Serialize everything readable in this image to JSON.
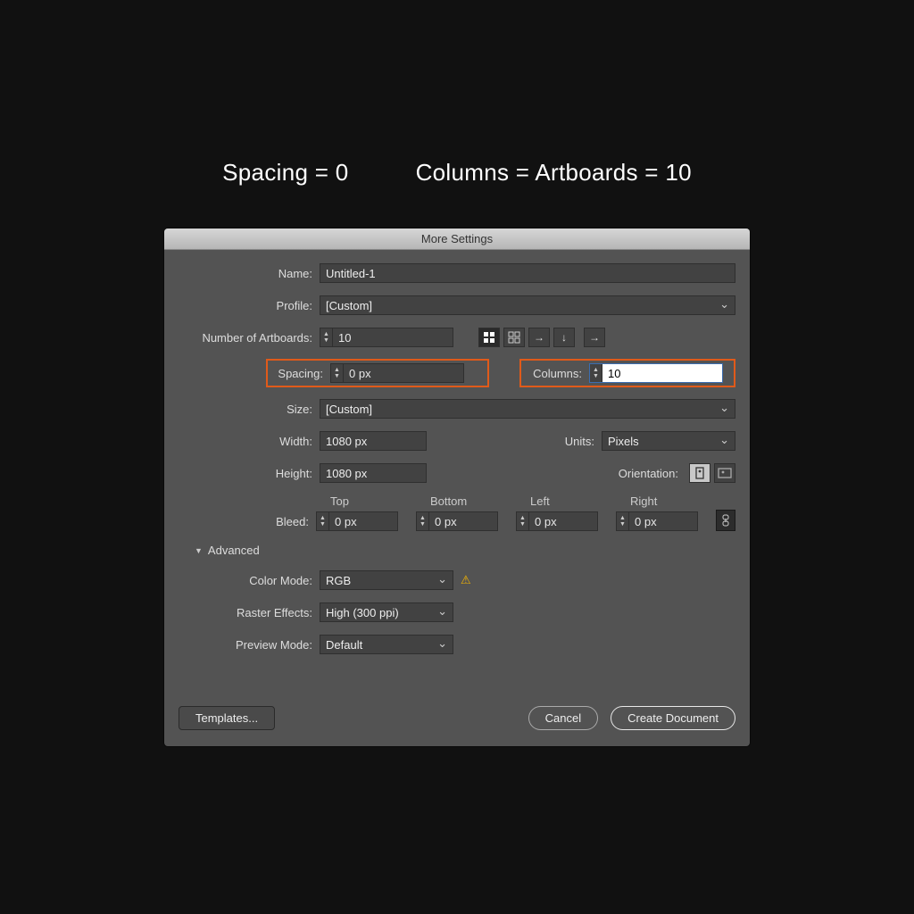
{
  "caption": {
    "left": "Spacing = 0",
    "right": "Columns = Artboards = 10"
  },
  "dialog": {
    "title": "More Settings",
    "name_label": "Name:",
    "name_value": "Untitled-1",
    "profile_label": "Profile:",
    "profile_value": "[Custom]",
    "artboards_label": "Number of Artboards:",
    "artboards_value": "10",
    "spacing_label": "Spacing:",
    "spacing_value": "0 px",
    "columns_label": "Columns:",
    "columns_value": "10",
    "size_label": "Size:",
    "size_value": "[Custom]",
    "width_label": "Width:",
    "width_value": "1080 px",
    "units_label": "Units:",
    "units_value": "Pixels",
    "height_label": "Height:",
    "height_value": "1080 px",
    "orientation_label": "Orientation:",
    "bleed_label": "Bleed:",
    "bleed": {
      "top_label": "Top",
      "top": "0 px",
      "bottom_label": "Bottom",
      "bottom": "0 px",
      "left_label": "Left",
      "left": "0 px",
      "right_label": "Right",
      "right": "0 px"
    },
    "advanced_label": "Advanced",
    "color_mode_label": "Color Mode:",
    "color_mode_value": "RGB",
    "raster_label": "Raster Effects:",
    "raster_value": "High (300 ppi)",
    "preview_label": "Preview Mode:",
    "preview_value": "Default",
    "templates_btn": "Templates...",
    "cancel_btn": "Cancel",
    "create_btn": "Create Document"
  }
}
